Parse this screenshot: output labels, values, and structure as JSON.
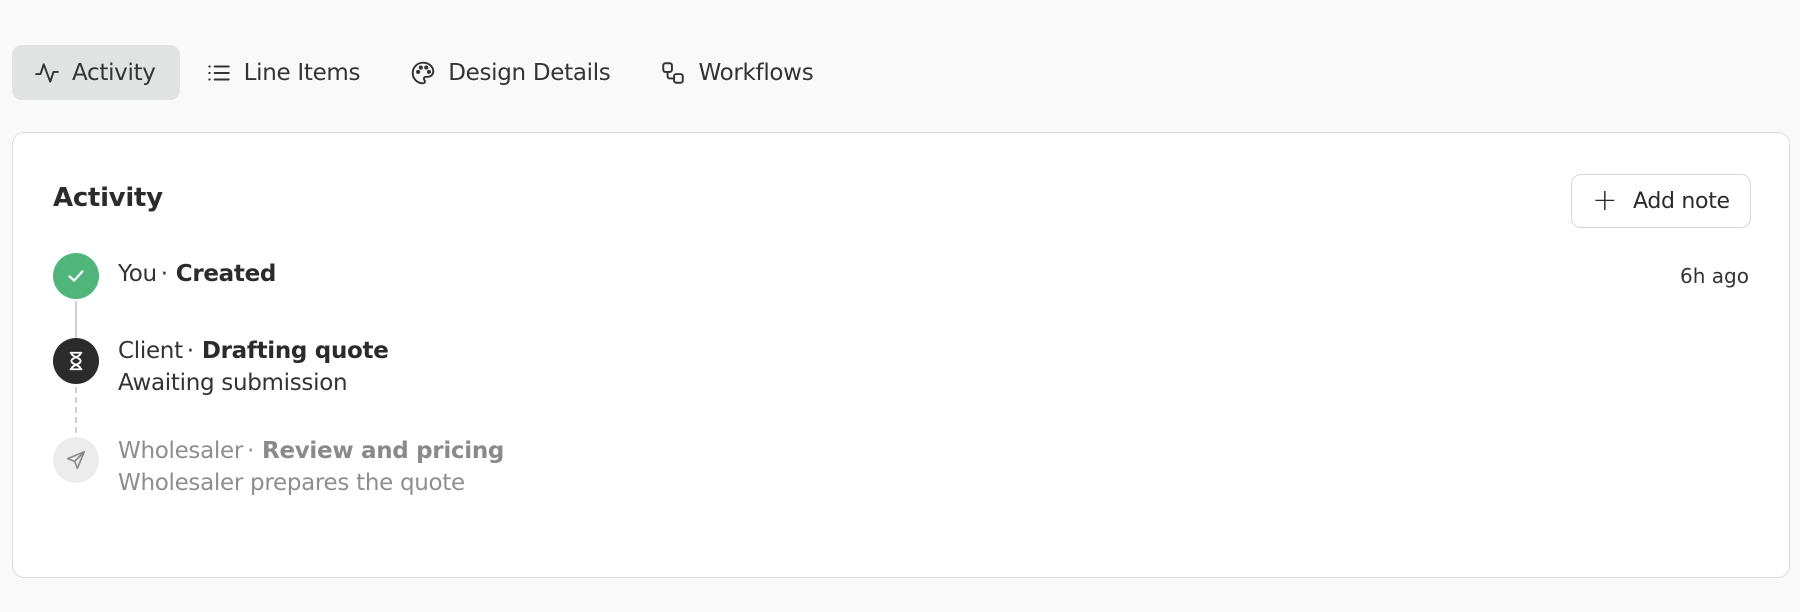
{
  "tabs": [
    {
      "label": "Activity",
      "icon": "activity-icon",
      "active": true
    },
    {
      "label": "Line Items",
      "icon": "list-icon",
      "active": false
    },
    {
      "label": "Design Details",
      "icon": "palette-icon",
      "active": false
    },
    {
      "label": "Workflows",
      "icon": "workflow-icon",
      "active": false
    }
  ],
  "activity": {
    "title": "Activity",
    "add_note_label": "Add note",
    "entries": [
      {
        "actor": "You",
        "separator": "·",
        "action": "Created",
        "subtitle": "",
        "time": "6h ago",
        "status": "completed",
        "icon": "check-icon",
        "color": "#4fb57a"
      },
      {
        "actor": "Client",
        "separator": "·",
        "action": "Drafting quote",
        "subtitle": "Awaiting submission",
        "time": "",
        "status": "in-progress",
        "icon": "hourglass-icon",
        "color": "#2b2b2b"
      },
      {
        "actor": "Wholesaler",
        "separator": "·",
        "action": "Review and pricing",
        "subtitle": "Wholesaler prepares the quote",
        "time": "",
        "status": "pending",
        "icon": "send-icon",
        "color": "#ececec"
      }
    ]
  }
}
